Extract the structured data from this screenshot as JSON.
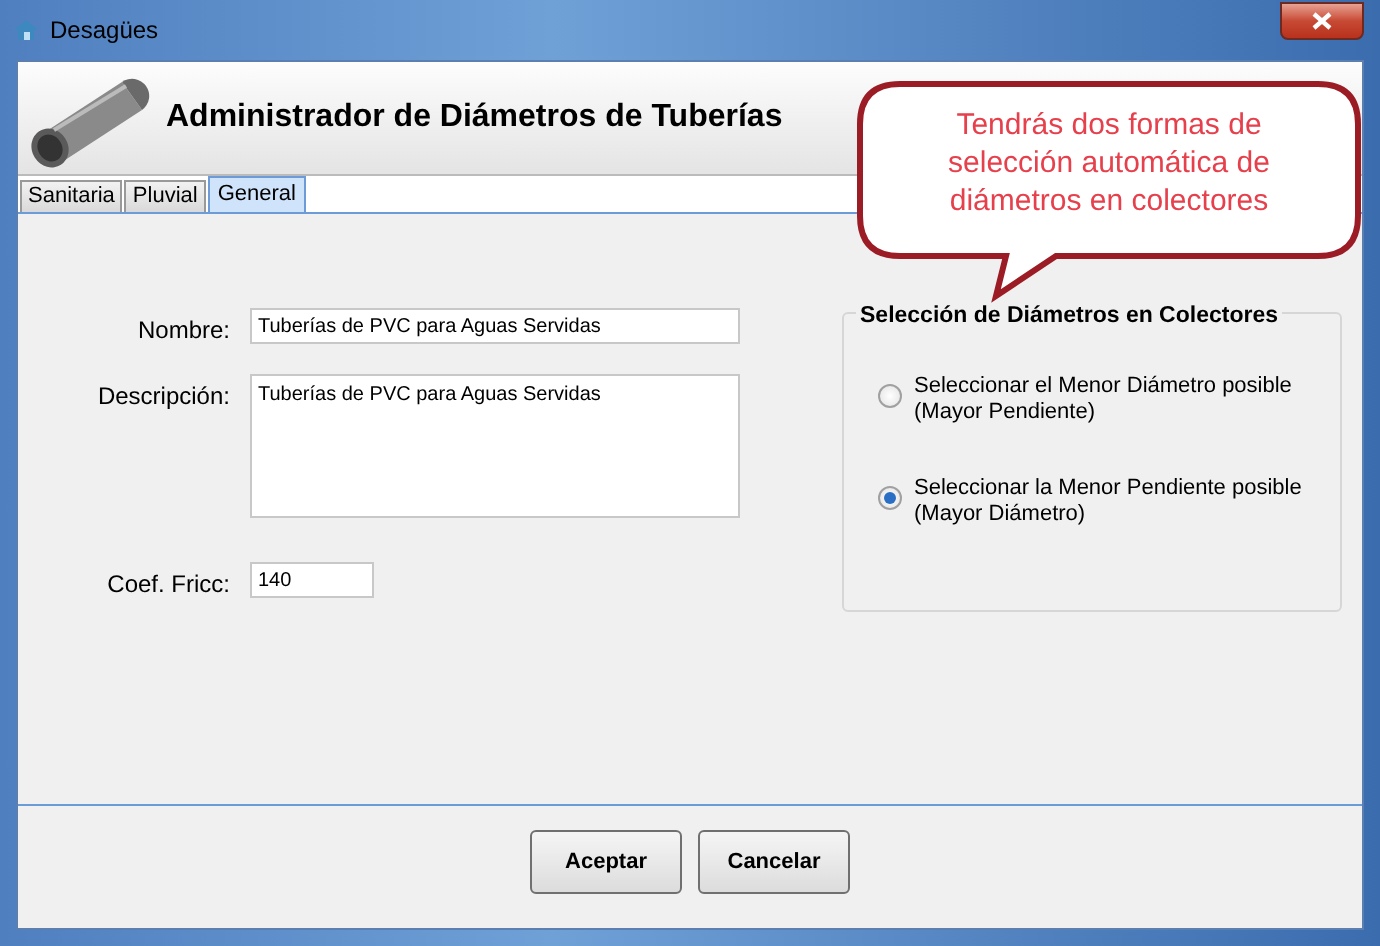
{
  "window": {
    "title": "Desagües"
  },
  "header": {
    "title": "Administrador de Diámetros de Tuberías"
  },
  "tabs": [
    {
      "label": "Sanitaria",
      "selected": false
    },
    {
      "label": "Pluvial",
      "selected": false
    },
    {
      "label": "General",
      "selected": true
    }
  ],
  "fields": [
    {
      "kind": "text",
      "label": "Nombre:",
      "value": "Tuberías de PVC para Aguas Servidas"
    },
    {
      "kind": "textarea",
      "label": "Descripción:",
      "value": "Tuberías de PVC para Aguas Servidas"
    },
    {
      "kind": "short",
      "label": "Coef. Fricc:",
      "value": "140"
    }
  ],
  "group": {
    "title": "Selección de Diámetros en Colectores",
    "options": [
      {
        "label": "Seleccionar el Menor Diámetro posible (Mayor Pendiente)",
        "selected": false
      },
      {
        "label": "Seleccionar la Menor Pendiente posible (Mayor Diámetro)",
        "selected": true
      }
    ]
  },
  "callout": {
    "text": "Tendrás dos formas de selección automática de diámetros en colectores"
  },
  "buttons": [
    "Aceptar",
    "Cancelar"
  ]
}
